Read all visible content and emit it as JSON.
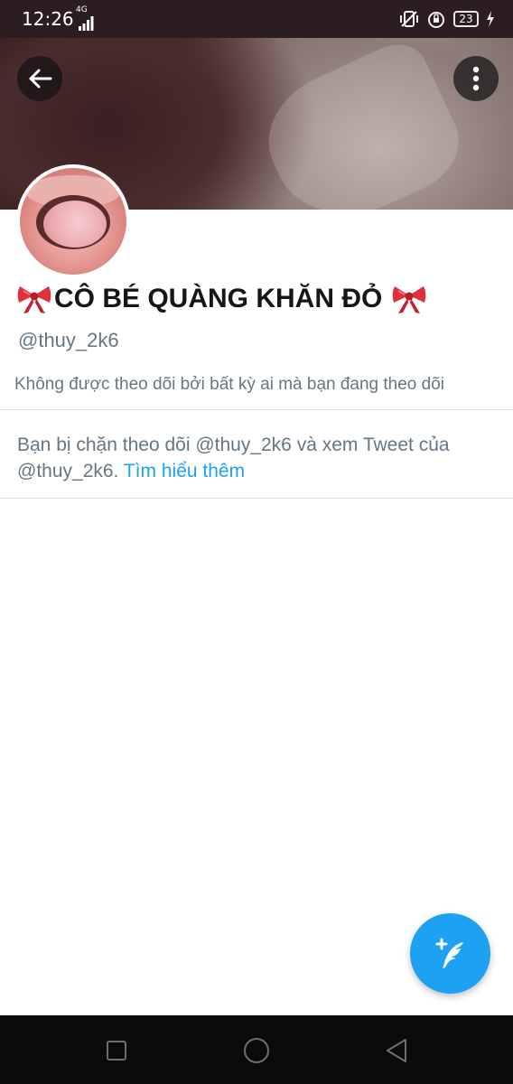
{
  "status_bar": {
    "time": "12:26",
    "network": "4G",
    "battery": "23"
  },
  "header": {
    "back_icon": "arrow-left-icon",
    "more_icon": "more-vertical-icon"
  },
  "profile": {
    "display_name": "CÔ BÉ QUÀNG KHĂN ĐỎ",
    "handle": "@thuy_2k6",
    "followed_by": "Không được theo dõi bởi bất kỳ ai mà bạn đang theo dõi",
    "name_emoji": "ribbon-bow-icon"
  },
  "blocked_notice": {
    "text": "Bạn bị chặn theo dõi @thuy_2k6 và xem Tweet của @thuy_2k6.",
    "link": "Tìm hiểu thêm"
  },
  "fab": {
    "icon": "compose-tweet-icon"
  },
  "nav_bar": {
    "icons": [
      "recent-apps-icon",
      "home-icon",
      "back-icon"
    ]
  },
  "colors": {
    "accent": "#1da1f2",
    "secondary_text": "#657786",
    "primary_text": "#14171a"
  }
}
